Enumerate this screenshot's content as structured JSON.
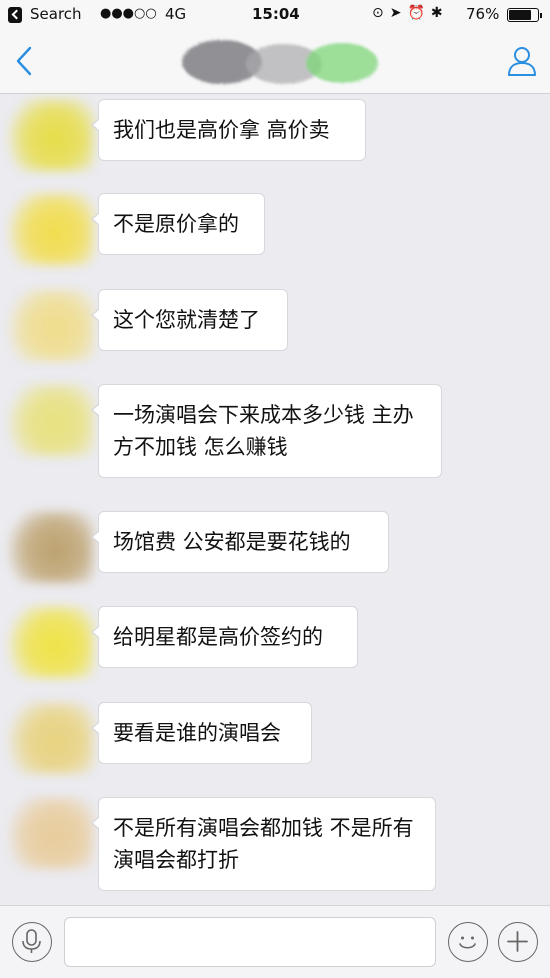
{
  "status_bar": {
    "back_app": "Search",
    "signal": "●●●○○",
    "network": "4G",
    "time": "15:04",
    "icons": "⊙➤⏰✱",
    "battery_percent": "76%"
  },
  "nav": {
    "back_icon": "chevron-left-icon",
    "profile_icon": "person-icon",
    "accent_color": "#2a8ee0"
  },
  "messages": [
    {
      "text": "我们也是高价拿 高价卖",
      "avatar_color": "#e6dc34"
    },
    {
      "text": "不是原价拿的",
      "avatar_color": "#f3dc3a"
    },
    {
      "text": "这个您就清楚了",
      "avatar_color": "#f0dc80"
    },
    {
      "text": "一场演唱会下来成本多少钱  主办方不加钱 怎么赚钱",
      "avatar_color": "#e8e070"
    },
    {
      "text": "场馆费 公安都是要花钱的",
      "avatar_color": "#b89a60"
    },
    {
      "text": "给明星都是高价签约的",
      "avatar_color": "#f0e232"
    },
    {
      "text": "要看是谁的演唱会",
      "avatar_color": "#e8d070"
    },
    {
      "text": "不是所有演唱会都加钱 不是所有演唱会都打折",
      "avatar_color": "#e8c890"
    }
  ],
  "input_bar": {
    "mic_icon": "microphone-icon",
    "emoji_icon": "smiley-icon",
    "plus_icon": "plus-icon"
  }
}
